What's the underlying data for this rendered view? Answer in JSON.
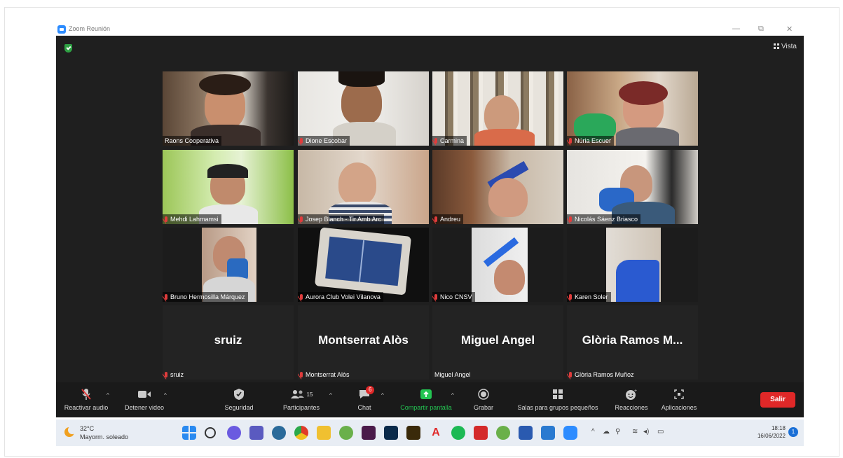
{
  "window": {
    "title": "Zoom Reunión",
    "minimize": "—",
    "restore": "⧉",
    "close": "✕"
  },
  "view_button": "Vista",
  "participants": [
    {
      "name": "Raons Cooperativa",
      "muted": false
    },
    {
      "name": "Dione Escobar",
      "muted": true
    },
    {
      "name": "Carmina",
      "muted": true
    },
    {
      "name": "Núria Escuer",
      "muted": true
    },
    {
      "name": "Mehdi Lahmamsi",
      "muted": true
    },
    {
      "name": "Josep Blanch - Tir Amb Arc",
      "muted": true
    },
    {
      "name": "Andreu",
      "muted": true
    },
    {
      "name": "Nicolás Sáenz Briasco",
      "muted": true
    },
    {
      "name": "Bruno Hermosilla Márquez",
      "muted": true
    },
    {
      "name": "Aurora Club Volei Vilanova",
      "muted": true
    },
    {
      "name": "Nico CNSV",
      "muted": true
    },
    {
      "name": "Karen Soler",
      "muted": true
    },
    {
      "name": "sruiz",
      "display": "sruiz",
      "muted": true
    },
    {
      "name": "Montserrat Alòs",
      "display": "Montserrat Alòs",
      "muted": true
    },
    {
      "name": "Miguel Angel",
      "display": "Miguel Angel",
      "muted": false
    },
    {
      "name": "Glòria Ramos Muñoz",
      "display": "Glòria Ramos M...",
      "muted": true
    }
  ],
  "toolbar": {
    "unmute": "Reactivar audio",
    "stop_video": "Detener video",
    "security": "Seguridad",
    "participants": "Participantes",
    "participants_count": "15",
    "chat": "Chat",
    "chat_badge": "6",
    "share": "Compartir pantalla",
    "record": "Grabar",
    "breakout": "Salas para grupos pequeños",
    "reactions": "Reacciones",
    "apps": "Aplicaciones",
    "leave": "Salir"
  },
  "taskbar": {
    "temp": "32°C",
    "weather": "Mayorm. soleado",
    "time": "18:18",
    "date": "16/06/2022",
    "notifications": "1",
    "icons": [
      "windows-icon",
      "search-icon",
      "chat-icon",
      "teams-icon",
      "settings-icon",
      "chrome-icon",
      "files-icon",
      "qgis-icon",
      "indesign-icon",
      "photoshop-icon",
      "illustrator-icon",
      "acrobat-icon",
      "spotify-icon",
      "acrobat-reader-icon",
      "qgis-icon",
      "word-icon",
      "photos-icon",
      "zoom-icon"
    ]
  },
  "colors": {
    "active_speaker": "#d6e04a",
    "leave": "#e02828",
    "share": "#23c552",
    "muted": "#e03c3c"
  }
}
